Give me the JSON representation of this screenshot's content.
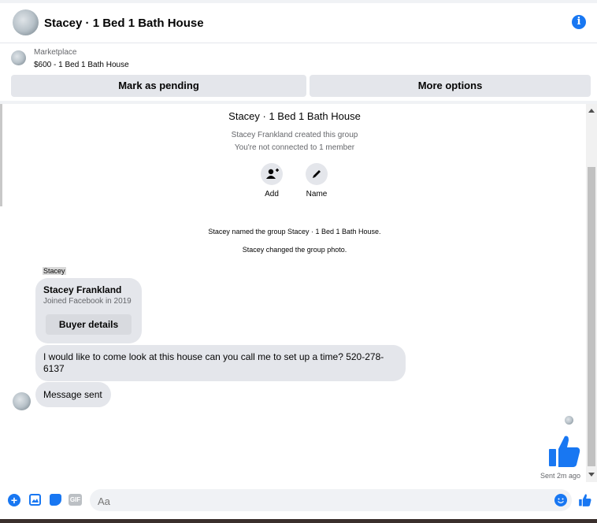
{
  "header": {
    "title": "Stacey · 1 Bed 1 Bath House"
  },
  "listing": {
    "category": "Marketplace",
    "price_title": "$600 - 1 Bed 1 Bath House"
  },
  "actions": {
    "mark_pending": "Mark as pending",
    "more_options": "More options"
  },
  "group": {
    "name": "Stacey · 1 Bed 1 Bath House",
    "created_by": "Stacey Frankland created this group",
    "connection": "You're not connected to 1 member",
    "add_label": "Add",
    "name_label": "Name"
  },
  "events": {
    "named": "Stacey named the group Stacey · 1 Bed 1 Bath House.",
    "photo": "Stacey changed the group photo."
  },
  "sender_label": "Stacey",
  "profile_card": {
    "name": "Stacey Frankland",
    "joined": "Joined Facebook in 2019",
    "button": "Buyer details"
  },
  "messages": [
    {
      "text": "I would like to come look at this house can you call me to set up a time? 520-278-6137"
    },
    {
      "text": "Message sent"
    }
  ],
  "sent_status": "Sent 2m ago",
  "composer": {
    "placeholder": "Aa"
  },
  "colors": {
    "accent": "#1877f2",
    "bubble": "#e4e6eb"
  }
}
